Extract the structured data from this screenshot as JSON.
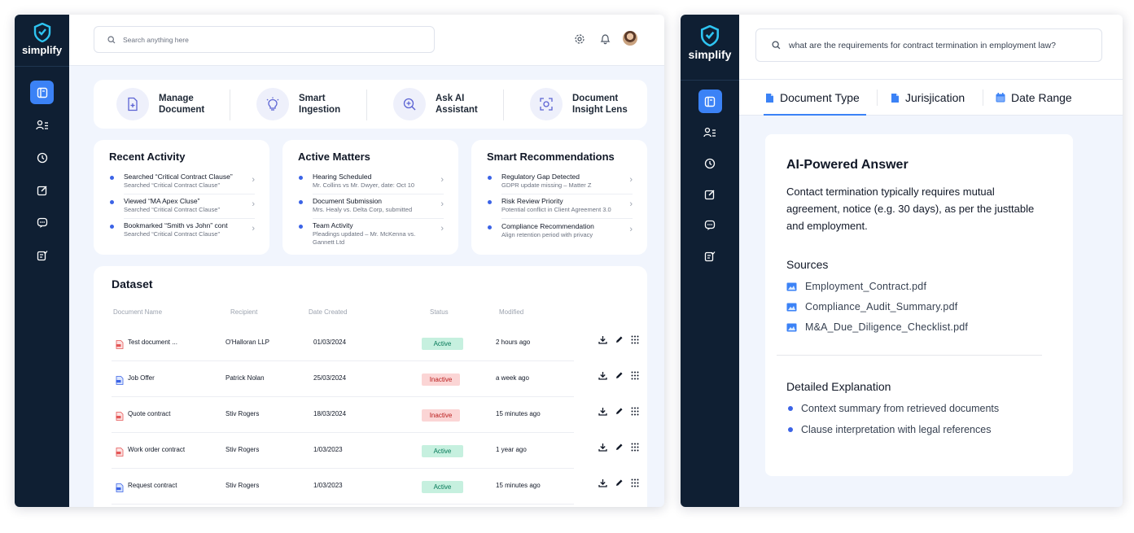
{
  "brand": {
    "name": "simplify"
  },
  "left": {
    "search": {
      "placeholder": "Search anything here"
    },
    "quick_actions": [
      {
        "label": "Manage\nDocument",
        "icon": "document-add-icon"
      },
      {
        "label": "Smart\nIngestion",
        "icon": "lightbulb-icon"
      },
      {
        "label": "Ask AI\nAssistant",
        "icon": "search-ai-icon"
      },
      {
        "label": "Document\nInsight Lens",
        "icon": "scan-icon"
      }
    ],
    "recent_activity": {
      "title": "Recent Activity",
      "items": [
        {
          "title": "Searched “Critical Contract Clause”",
          "sub": "Searched “Critical Contract Clause”"
        },
        {
          "title": "Viewed “MA Apex Cluse”",
          "sub": "Searched “Critical Contract Clause”"
        },
        {
          "title": "Bookmarked “Smith vs John” cont",
          "sub": "Searched “Critical Contract Clause”"
        }
      ]
    },
    "active_matters": {
      "title": "Active Matters",
      "items": [
        {
          "title": "Hearing Scheduled",
          "sub": "Mr. Collins vs Mr. Dwyer, date: Oct 10"
        },
        {
          "title": "Document Submission",
          "sub": "Mrs. Healy vs. Delta Corp, submitted"
        },
        {
          "title": "Team Activity",
          "sub": "Pleadings updated – Mr. McKenna vs. Gannett Ltd"
        }
      ]
    },
    "smart_recommendations": {
      "title": "Smart Recommendations",
      "items": [
        {
          "title": "Regulatory Gap Detected",
          "sub": "GDPR update missing – Matter Z"
        },
        {
          "title": "Risk Review Priority",
          "sub": "Potential conflict in Client Agreement 3.0"
        },
        {
          "title": "Compliance Recommendation",
          "sub": "Align retention period with privacy"
        }
      ]
    },
    "dataset": {
      "title": "Dataset",
      "columns": [
        "Document Name",
        "Recipient",
        "Date Created",
        "Status",
        "Modified"
      ],
      "rows": [
        {
          "name": "Test  document ...",
          "file_icon": "pdf-icon",
          "recipient": "O'Halloran LLP",
          "date": "01/03/2024",
          "status": "Active",
          "modified": "2 hours ago"
        },
        {
          "name": "Job Offer",
          "file_icon": "doc-icon",
          "recipient": "Patrick Nolan",
          "date": "25/03/2024",
          "status": "Inactive",
          "modified": "a week ago"
        },
        {
          "name": "Quote contract",
          "file_icon": "pdf-icon",
          "recipient": "Stiv Rogers",
          "date": "18/03/2024",
          "status": "Inactive",
          "modified": "15 minutes ago"
        },
        {
          "name": "Work order contract",
          "file_icon": "pdf-icon",
          "recipient": "Stiv Rogers",
          "date": "1/03/2023",
          "status": "Active",
          "modified": "1 year ago"
        },
        {
          "name": "Request contract",
          "file_icon": "doc-icon",
          "recipient": "Stiv Rogers",
          "date": "1/03/2023",
          "status": "Active",
          "modified": "15 minutes ago"
        }
      ]
    }
  },
  "right": {
    "search": {
      "value": "what are the requirements for contract termination in employment law?"
    },
    "tabs": [
      {
        "label": "Document Type",
        "icon": "document-icon",
        "active": true
      },
      {
        "label": "Jurisjication",
        "icon": "document-icon",
        "active": false
      },
      {
        "label": "Date Range",
        "icon": "calendar-icon",
        "active": false
      }
    ],
    "answer": {
      "title": "AI-Powered Answer",
      "body": "Contact termination typically requires mutual agreement, notice (e.g. 30 days), as per the justtable and employment.",
      "sources_title": "Sources",
      "sources": [
        "Employment_Contract.pdf",
        "Compliance_Audit_Summary.pdf",
        "M&A_Due_Diligence_Checklist.pdf"
      ],
      "explanation_title": "Detailed Explanation",
      "explanation": [
        "Context summary from retrieved documents",
        "Clause interpretation with legal references"
      ]
    }
  },
  "colors": {
    "sidebar": "#0f1f33",
    "accent": "#3b82f6",
    "active_badge": "#c6f0df",
    "inactive_badge": "#fbd5d5"
  }
}
